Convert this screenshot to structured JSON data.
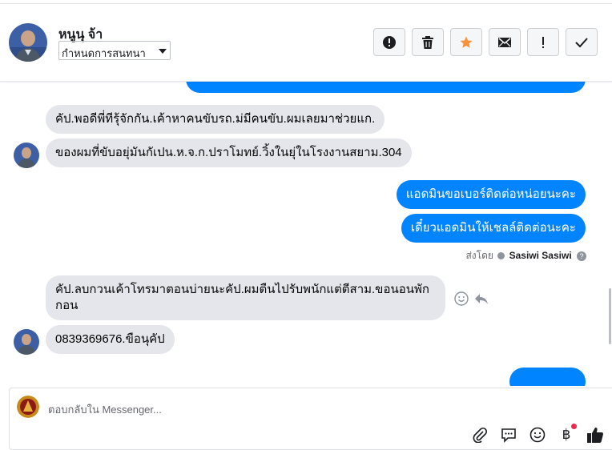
{
  "header": {
    "contact_name": "หนูนุ จ้า",
    "label_select": "กำหนดการสนทนา",
    "toolbar": [
      {
        "name": "report-button",
        "icon": "exclamation-circle-icon"
      },
      {
        "name": "delete-button",
        "icon": "trash-icon"
      },
      {
        "name": "star-button",
        "icon": "star-icon"
      },
      {
        "name": "mark-unread-button",
        "icon": "envelope-icon"
      },
      {
        "name": "important-button",
        "icon": "exclamation-icon"
      },
      {
        "name": "done-button",
        "icon": "check-icon"
      }
    ],
    "colors": {
      "star": "#f7923b"
    }
  },
  "messages": {
    "m1": "คัป.พอดีพี่ทีรุ้จักกัน.เค้าหาคนขับรถ.ม่มีคนขับ.ผมเลยมาช่วยแก.",
    "m2": "ของผมที่ขับอยุ่มันกัเปน.ห.จ.ก.ปราโมทย์.วิ้งในยุ่ในโรงงานสยาม.304",
    "m3": "แอดมินขอเบอร์ติดต่อหน่อยนะคะ",
    "m4": "เดี๋ยวแอดมินให้เชลล์ติดต่อนะคะ",
    "sent_by_prefix": "ส่งโดย",
    "sent_by_name": "Sasiwi Sasiwi",
    "m5": "คัป.ลบกวนเค้าโทรมาตอนบ่ายนะคัป.ผมตืนไปรับพนักแต่ตีสาม.ขอนอนพักกอน",
    "m6": "0839369676.ขือนุคัป"
  },
  "colors": {
    "outgoing": "#0084ff",
    "incoming": "#e4e6eb"
  },
  "composer": {
    "placeholder": "ตอบกลับใน Messenger...",
    "icons": [
      "paperclip-icon",
      "saved-reply-icon",
      "emoji-icon",
      "baht-payment-icon",
      "thumbs-up-icon"
    ]
  }
}
